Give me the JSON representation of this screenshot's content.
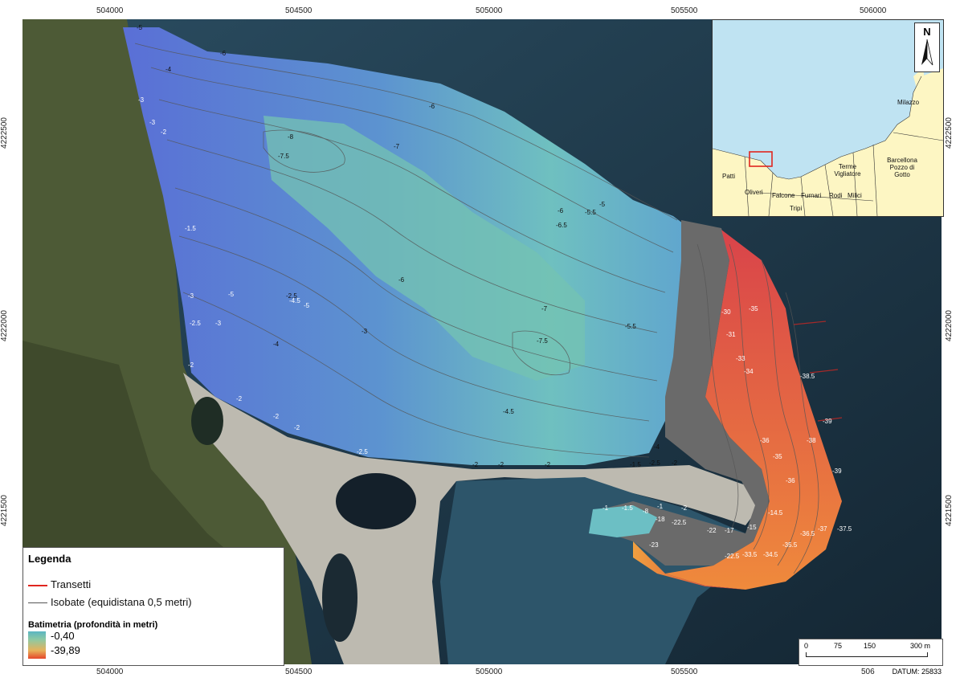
{
  "frame": {
    "x_ticks": [
      "504000",
      "504500",
      "505000",
      "505500",
      "506000"
    ],
    "y_ticks": [
      "4222500",
      "4222000",
      "4221500"
    ],
    "bottom_right_tick": "506",
    "datum": "DATUM: 25833"
  },
  "map": {
    "colors": {
      "sea_dark": "#1d3347",
      "sea_mid": "#2f5b73",
      "land_green": "#4f5b35",
      "beach": "#c9c6bd",
      "shallow": "#6cbfc4",
      "mid_blue": "#5f8fd6",
      "deep_red": "#d63a4a",
      "orange": "#f08a3a"
    },
    "depth_labels": [
      "-5",
      "-6",
      "-4",
      "-3",
      "-3",
      "-2",
      "-8",
      "-7.5",
      "-7",
      "-6",
      "-6",
      "-5.5",
      "-5",
      "-6.5",
      "-1.5",
      "-3",
      "-2.5",
      "-3",
      "-5",
      "-4.5",
      "-5",
      "-4",
      "-2.5",
      "-6",
      "-7",
      "-7.5",
      "-5.5",
      "-3",
      "-2",
      "-2",
      "-2",
      "-2",
      "-2.5",
      "-4.5",
      "-4",
      "-1.5",
      "-2.5",
      "-2",
      "-2",
      "-2",
      "-2",
      "-1",
      "-1.5",
      "-8",
      "-18",
      "-1",
      "-2",
      "-22.5",
      "-22",
      "-17",
      "-15",
      "-14.5",
      "-23",
      "-22.5",
      "-33.5",
      "-34.5",
      "-35.5",
      "-36.5",
      "-37",
      "-37.5",
      "-39",
      "-38",
      "-39",
      "-38.5",
      "-34",
      "-33",
      "-35",
      "-31",
      "-30",
      "-36",
      "-35",
      "-36"
    ]
  },
  "inset": {
    "towns": [
      "Milazzo",
      "Barcellona Pozzo di Gotto",
      "Terme Vigliatore",
      "Patti",
      "Oliveri",
      "Falcone",
      "Furnari",
      "Rodi",
      "Milici",
      "Tripi"
    ],
    "north_label": "N"
  },
  "legend": {
    "title": "Legenda",
    "items": [
      {
        "label": "Transetti",
        "color": "#e0261f"
      },
      {
        "label": "Isobate (equidistana 0,5 metri)",
        "color": "#555555"
      }
    ],
    "bathymetry_title": "Batimetria (profondità in metri)",
    "max": "-0,40",
    "min": "-39,89"
  },
  "scalebar": {
    "labels": [
      "0",
      "75",
      "150",
      "300 m"
    ]
  }
}
